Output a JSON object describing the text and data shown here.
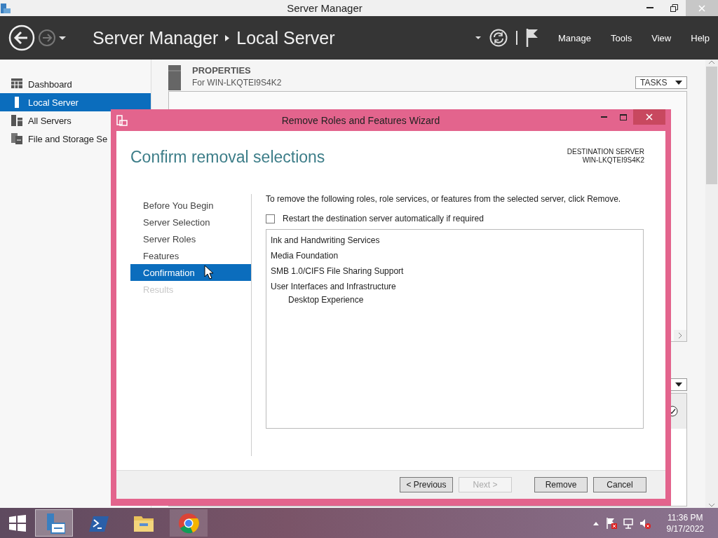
{
  "window": {
    "title": "Server Manager"
  },
  "header": {
    "breadcrumb": [
      "Server Manager",
      "Local Server"
    ],
    "menu": [
      "Manage",
      "Tools",
      "View",
      "Help"
    ]
  },
  "sidebar": {
    "items": [
      {
        "label": "Dashboard",
        "kind": "dashboard",
        "selected": false
      },
      {
        "label": "Local Server",
        "kind": "local",
        "selected": true
      },
      {
        "label": "All Servers",
        "kind": "servers",
        "selected": false
      },
      {
        "label": "File and Storage Se",
        "kind": "storage",
        "selected": false
      }
    ]
  },
  "properties": {
    "title": "PROPERTIES",
    "subtitle": "For WIN-LKQTEI9S4K2",
    "tasks": "TASKS"
  },
  "dialog": {
    "title": "Remove Roles and Features Wizard",
    "heading": "Confirm removal selections",
    "destination_label": "DESTINATION SERVER",
    "destination": "WIN-LKQTEI9S4K2",
    "steps": [
      {
        "label": "Before You Begin",
        "selected": false,
        "disabled": false
      },
      {
        "label": "Server Selection",
        "selected": false,
        "disabled": false
      },
      {
        "label": "Server Roles",
        "selected": false,
        "disabled": false
      },
      {
        "label": "Features",
        "selected": false,
        "disabled": false
      },
      {
        "label": "Confirmation",
        "selected": true,
        "disabled": false
      },
      {
        "label": "Results",
        "selected": false,
        "disabled": true
      }
    ],
    "instruction": "To remove the following roles, role services, or features from the selected server, click Remove.",
    "restart": {
      "label": "Restart the destination server automatically if required",
      "checked": false
    },
    "features": [
      {
        "label": "Ink and Handwriting Services"
      },
      {
        "label": "Media Foundation"
      },
      {
        "label": "SMB 1.0/CIFS File Sharing Support"
      },
      {
        "label": "User Interfaces and Infrastructure",
        "children": [
          {
            "label": "Desktop Experience"
          }
        ]
      }
    ],
    "buttons": [
      {
        "label": "< Previous",
        "disabled": false
      },
      {
        "label": "Next >",
        "disabled": true
      },
      {
        "label": "Remove",
        "disabled": false
      },
      {
        "label": "Cancel",
        "disabled": false
      }
    ]
  },
  "taskbar": {
    "apps": [
      {
        "kind": "server-manager",
        "selected": true,
        "hovered": false
      },
      {
        "kind": "powershell",
        "selected": false,
        "hovered": false
      },
      {
        "kind": "explorer",
        "selected": false,
        "hovered": false
      },
      {
        "kind": "chrome",
        "selected": false,
        "hovered": true
      }
    ],
    "clock": {
      "time": "11:36 PM",
      "date": "9/17/2022"
    }
  }
}
